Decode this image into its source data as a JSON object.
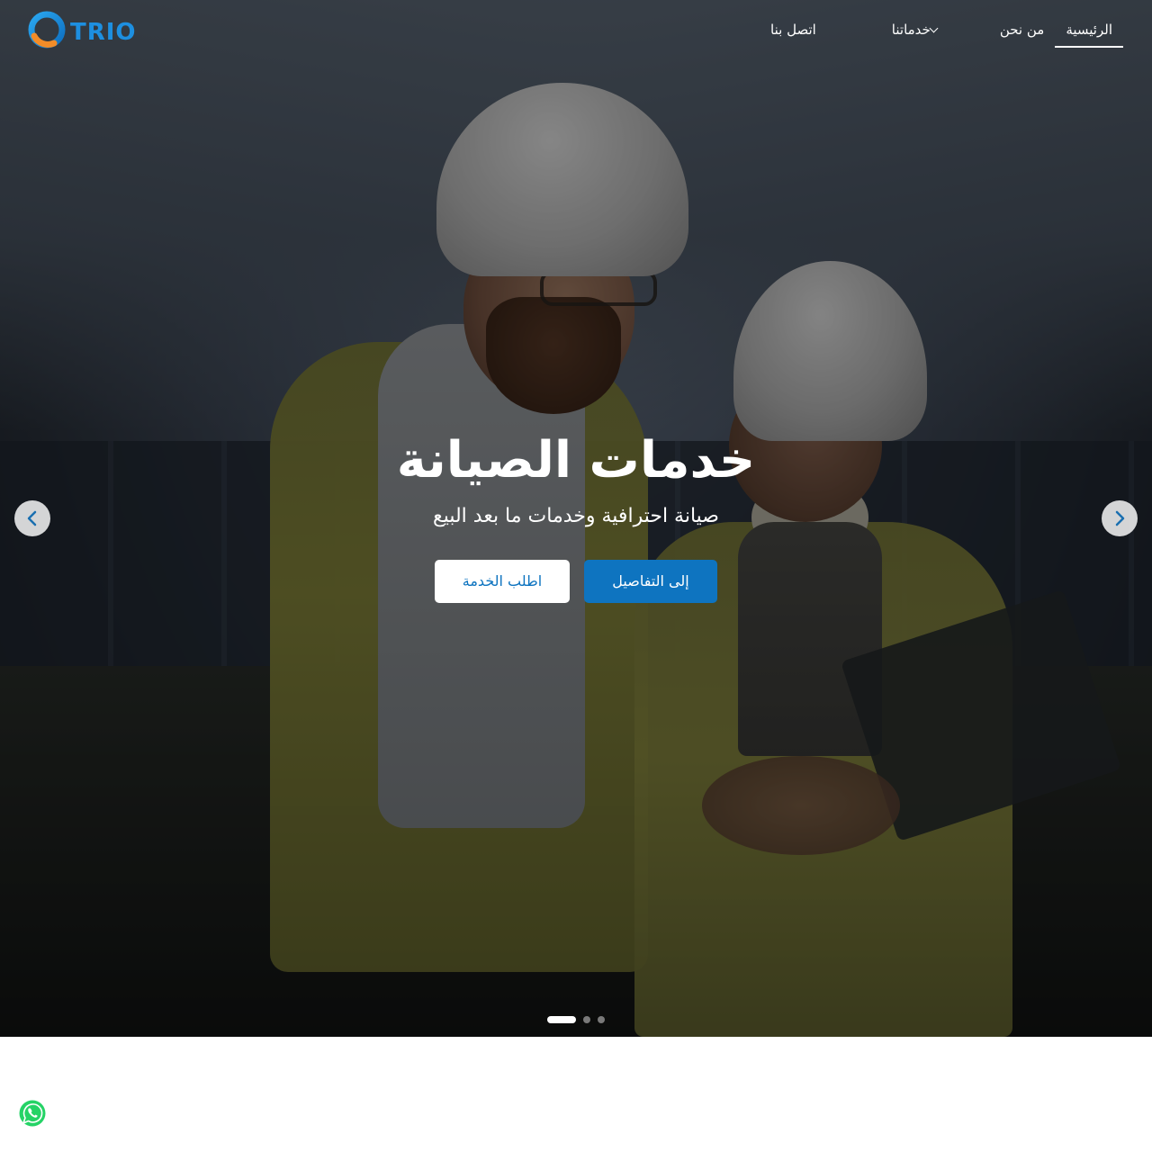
{
  "brand": {
    "logo_text": "TRIO",
    "accent": "#0e74c0",
    "logo_orange": "#f28c28"
  },
  "nav": {
    "items": [
      {
        "label": "الرئيسية",
        "active": true
      },
      {
        "label": "من نحن",
        "active": false
      },
      {
        "label": "خدماتنا",
        "active": false,
        "has_dropdown": true
      },
      {
        "label": "اتصل بنا",
        "active": false
      }
    ]
  },
  "hero": {
    "title": "خدمات الصيانة",
    "subtitle": "صيانة احترافية وخدمات ما بعد البيع",
    "primary_button": "إلى التفاصيل",
    "secondary_button": "اطلب الخدمة",
    "slides_total": 3,
    "active_slide": 1,
    "prev_icon": "chevron-left-icon",
    "next_icon": "chevron-right-icon"
  },
  "floating": {
    "whatsapp_icon": "whatsapp-icon",
    "whatsapp_color": "#25d366"
  }
}
